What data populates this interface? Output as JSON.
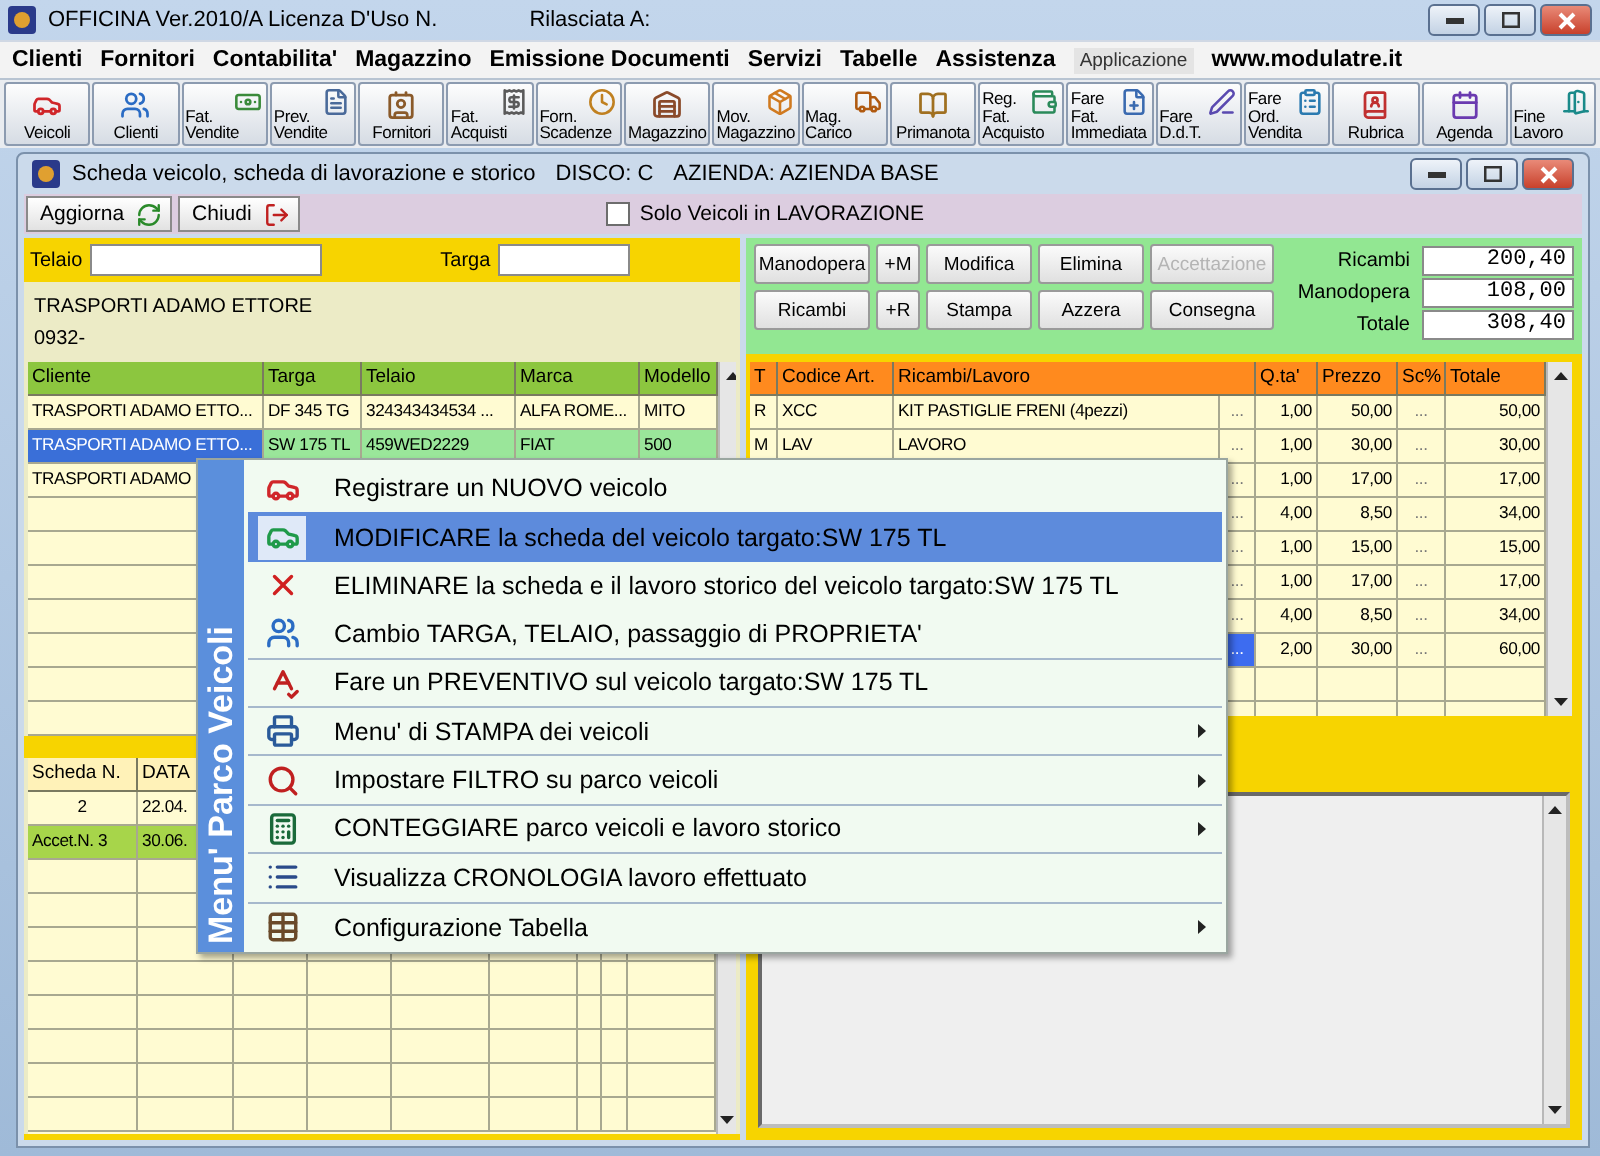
{
  "app_window": {
    "title": "OFFICINA Ver.2010/A  Licenza D'Uso N.",
    "issued_to": "Rilasciata A:"
  },
  "menu_bar": {
    "items": [
      "Clienti",
      "Fornitori",
      "Contabilita'",
      "Magazzino",
      "Emissione Documenti",
      "Servizi",
      "Tabelle",
      "Assistenza"
    ],
    "app_label": "Applicazione",
    "website": "www.modulatre.it"
  },
  "toolbar": [
    {
      "lines": [
        "Veicoli"
      ]
    },
    {
      "lines": [
        "Clienti"
      ]
    },
    {
      "lines": [
        "Fat.",
        "Vendite"
      ]
    },
    {
      "lines": [
        "Prev.",
        "Vendite"
      ]
    },
    {
      "lines": [
        "Fornitori"
      ]
    },
    {
      "lines": [
        "Fat.",
        "Acquisti"
      ]
    },
    {
      "lines": [
        "Forn.",
        "Scadenze"
      ]
    },
    {
      "lines": [
        "Magazzino"
      ]
    },
    {
      "lines": [
        "Mov.",
        "Magazzino"
      ]
    },
    {
      "lines": [
        "Mag.",
        "Carico"
      ]
    },
    {
      "lines": [
        "Primanota"
      ]
    },
    {
      "lines": [
        "Reg.",
        "Fat.",
        "Acquisto"
      ]
    },
    {
      "lines": [
        "Fare",
        "Fat.",
        "Immediata"
      ]
    },
    {
      "lines": [
        "Fare",
        "D.d.T."
      ]
    },
    {
      "lines": [
        "Fare",
        "Ord.",
        "Vendita"
      ]
    },
    {
      "lines": [
        "Rubrica"
      ]
    },
    {
      "lines": [
        "Agenda"
      ]
    },
    {
      "lines": [
        "Fine",
        "Lavoro"
      ]
    }
  ],
  "child_window": {
    "title": "Scheda veicolo, scheda di lavorazione e storico",
    "disk": "DISCO: C",
    "company": "AZIENDA: AZIENDA BASE"
  },
  "actions": {
    "buttons": [
      "Aggiorna",
      "Chiudi"
    ],
    "only_in_progress": {
      "label": "Solo Veicoli in LAVORAZIONE",
      "checked": false
    }
  },
  "filter": {
    "chassis_label": "Telaio",
    "plate_label": "Targa"
  },
  "customer": {
    "name": "TRASPORTI ADAMO ETTORE",
    "code": "0932-"
  },
  "vehicles": {
    "columns": [
      "Cliente",
      "Targa",
      "Telaio",
      "Marca",
      "Modello"
    ],
    "rows": [
      {
        "cells": [
          "TRASPORTI ADAMO ETTO...",
          "DF 345 TG",
          "324343434534 ...",
          "ALFA ROME...",
          "MITO"
        ],
        "selected": false
      },
      {
        "cells": [
          "TRASPORTI ADAMO ETTO...",
          "SW 175 TL",
          "459WED2229",
          "FIAT",
          "500"
        ],
        "selected": true
      },
      {
        "cells": [
          "TRASPORTI ADAMO"
        ],
        "selected": false
      }
    ]
  },
  "history": {
    "columns": [
      "Scheda N.",
      "DATA"
    ],
    "rows": [
      {
        "cells": [
          "2",
          "22.04."
        ],
        "kind": "card"
      },
      {
        "cells": [
          "Accet.N.  3",
          "30.06."
        ],
        "kind": "acceptance"
      }
    ]
  },
  "work_buttons": [
    {
      "label": "Manodopera",
      "disabled": false
    },
    {
      "label": "+M",
      "disabled": false
    },
    {
      "label": "Modifica",
      "disabled": false
    },
    {
      "label": "Elimina",
      "disabled": false
    },
    {
      "label": "Accettazione",
      "disabled": true
    },
    {
      "label": "Ricambi",
      "disabled": false
    },
    {
      "label": "+R",
      "disabled": false
    },
    {
      "label": "Stampa",
      "disabled": false
    },
    {
      "label": "Azzera",
      "disabled": false
    },
    {
      "label": "Consegna",
      "disabled": false
    }
  ],
  "totals": [
    {
      "label": "Ricambi",
      "value": "200,40"
    },
    {
      "label": "Manodopera",
      "value": "108,00"
    },
    {
      "label": "Totale",
      "value": "308,40"
    }
  ],
  "items": {
    "columns": [
      "T",
      "Codice Art.",
      "Ricambi/Lavoro",
      "Q.ta'",
      "Prezzo",
      "Sc%",
      "Totale"
    ],
    "rows": [
      {
        "type": "R",
        "code": "XCC",
        "description": "KIT PASTIGLIE FRENI (4pezzi)",
        "more": "...",
        "qty": "1,00",
        "price": "50,00",
        "discount": "...",
        "total": "50,00",
        "selected": false
      },
      {
        "type": "M",
        "code": "LAV",
        "description": "LAVORO",
        "more": "...",
        "qty": "1,00",
        "price": "30,00",
        "discount": "...",
        "total": "30,00",
        "selected": false
      },
      {
        "more": "...",
        "qty": "1,00",
        "price": "17,00",
        "discount": "...",
        "total": "17,00",
        "selected": false
      },
      {
        "more": "...",
        "qty": "4,00",
        "price": "8,50",
        "discount": "...",
        "total": "34,00",
        "selected": false
      },
      {
        "more": "...",
        "qty": "1,00",
        "price": "15,00",
        "discount": "...",
        "total": "15,00",
        "selected": false
      },
      {
        "more": "...",
        "qty": "1,00",
        "price": "17,00",
        "discount": "...",
        "total": "17,00",
        "selected": false
      },
      {
        "more": "...",
        "qty": "4,00",
        "price": "8,50",
        "discount": "...",
        "total": "34,00",
        "selected": false
      },
      {
        "more": "...",
        "qty": "2,00",
        "price": "30,00",
        "discount": "...",
        "total": "60,00",
        "selected": true
      }
    ]
  },
  "context_menu": {
    "title": "Menu' Parco Veicoli",
    "items": [
      {
        "label": "Registrare un NUOVO veicolo",
        "submenu": false,
        "selected": false
      },
      {
        "label": "MODIFICARE la scheda del veicolo targato:SW 175 TL",
        "submenu": false,
        "selected": true
      },
      {
        "label": "ELIMINARE la scheda e il lavoro storico del veicolo targato:SW 175 TL",
        "submenu": false,
        "selected": false
      },
      {
        "label": "Cambio TARGA, TELAIO, passaggio di PROPRIETA'",
        "submenu": false,
        "selected": false
      },
      {
        "label": "Fare un PREVENTIVO sul veicolo targato:SW 175 TL",
        "submenu": false,
        "selected": false
      },
      {
        "label": "Menu' di STAMPA dei veicoli",
        "submenu": true,
        "selected": false
      },
      {
        "label": "Impostare FILTRO su parco veicoli",
        "submenu": true,
        "selected": false
      },
      {
        "label": "CONTEGGIARE parco veicoli e lavoro storico",
        "submenu": true,
        "selected": false
      },
      {
        "label": "Visualizza CRONOLOGIA lavoro effettuato",
        "submenu": false,
        "selected": false
      },
      {
        "label": "Configurazione Tabella",
        "submenu": true,
        "selected": false
      }
    ]
  }
}
